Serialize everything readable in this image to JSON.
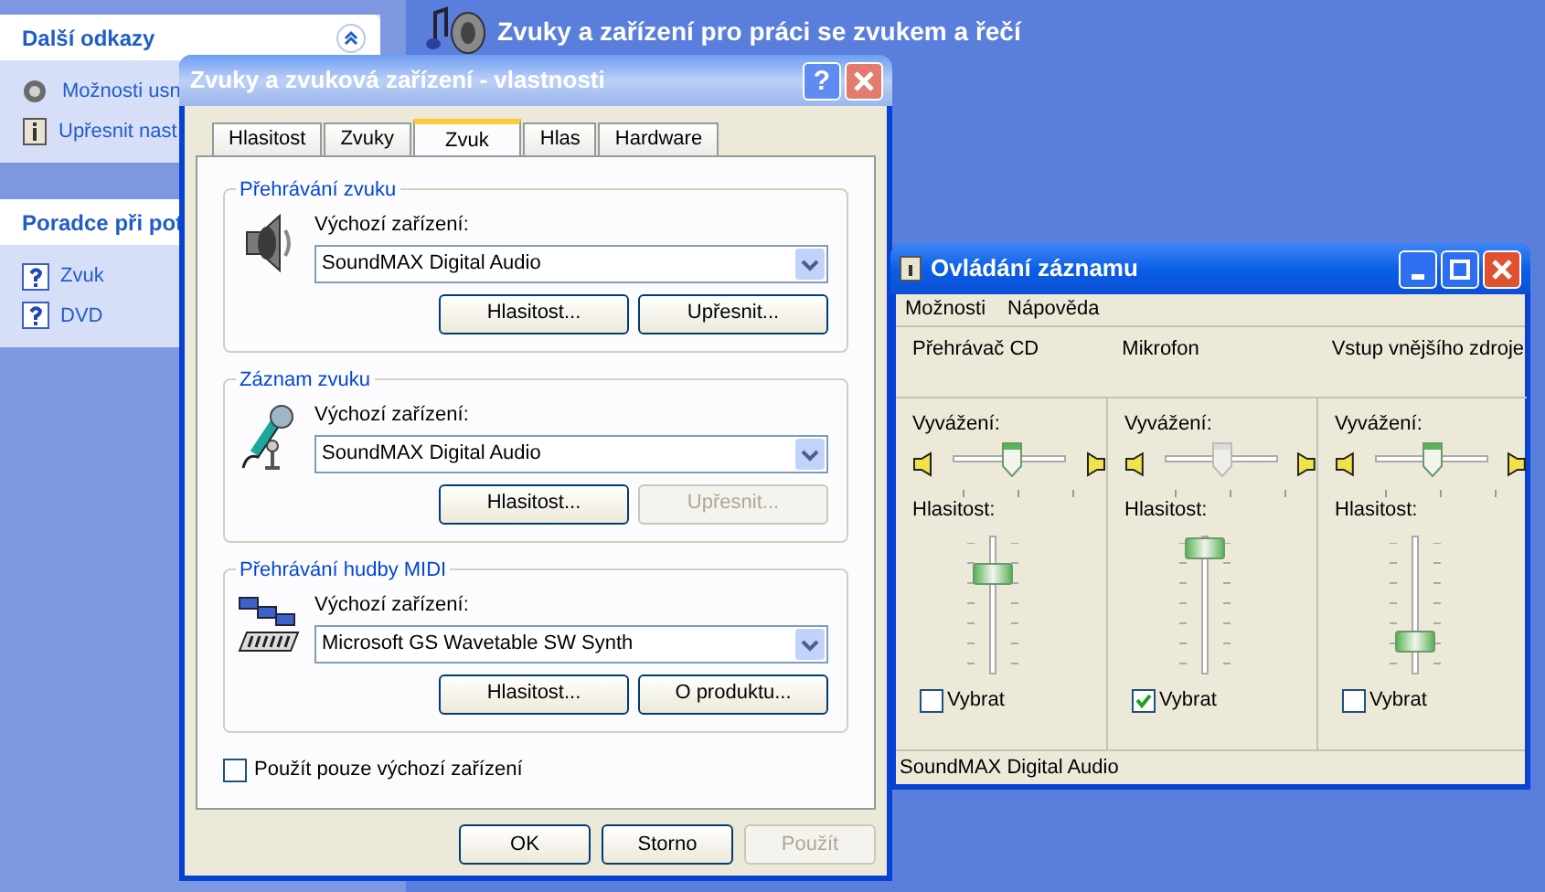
{
  "desktop_header": {
    "title": "Zvuky a zařízení pro práci se zvukem a řečí"
  },
  "sidebar": [
    {
      "title": "Další odkazy",
      "expanded": true,
      "items": [
        {
          "label": "Možnosti usn",
          "kind": "speaker"
        },
        {
          "label": "Upřesnit nast",
          "kind": "info"
        }
      ]
    },
    {
      "title": "Poradce při pot",
      "items": [
        {
          "label": "Zvuk",
          "kind": "help"
        },
        {
          "label": "DVD",
          "kind": "help"
        }
      ]
    }
  ],
  "properties_dialog": {
    "title": "Zvuky a zvuková zařízení - vlastnosti",
    "help_glyph": "?",
    "tabs": [
      {
        "label": "Hlasitost",
        "selected": false
      },
      {
        "label": "Zvuky",
        "selected": false
      },
      {
        "label": "Zvuk",
        "selected": true
      },
      {
        "label": "Hlas",
        "selected": false
      },
      {
        "label": "Hardware",
        "selected": false
      }
    ],
    "groups": [
      {
        "title": "Přehrávání zvuku",
        "kind": "speaker",
        "label": "Výchozí zařízení:",
        "device": "SoundMAX Digital Audio",
        "buttons": [
          {
            "label": "Hlasitost...",
            "disabled": false
          },
          {
            "label": "Upřesnit...",
            "disabled": false
          }
        ]
      },
      {
        "title": "Záznam zvuku",
        "kind": "microphone",
        "label": "Výchozí zařízení:",
        "device": "SoundMAX Digital Audio",
        "buttons": [
          {
            "label": "Hlasitost...",
            "disabled": false
          },
          {
            "label": "Upřesnit...",
            "disabled": true
          }
        ]
      },
      {
        "title": "Přehrávání hudby MIDI",
        "kind": "midi",
        "label": "Výchozí zařízení:",
        "device": "Microsoft GS Wavetable SW Synth",
        "buttons": [
          {
            "label": "Hlasitost...",
            "disabled": false
          },
          {
            "label": "O produktu...",
            "disabled": false
          }
        ]
      }
    ],
    "default_only": {
      "label": "Použít pouze výchozí zařízení",
      "checked": false
    },
    "buttons": [
      {
        "label": "OK",
        "disabled": false
      },
      {
        "label": "Storno",
        "disabled": false
      },
      {
        "label": "Použít",
        "disabled": true
      }
    ]
  },
  "recording_control": {
    "title": "Ovládání záznamu",
    "menu": [
      "Možnosti",
      "Nápověda"
    ],
    "channels": [
      {
        "name": "Přehrávač CD",
        "balance_label": "Vyvážení:",
        "balance": {
          "level": 0.5,
          "disabled": false
        },
        "volume_label": "Hlasitost:",
        "volume": {
          "level": 0.73
        },
        "select": {
          "label": "Vybrat",
          "checked": false
        }
      },
      {
        "name": "Mikrofon",
        "balance_label": "Vyvážení:",
        "balance": {
          "level": 0.5,
          "disabled": true
        },
        "volume_label": "Hlasitost:",
        "volume": {
          "level": 0.95
        },
        "select": {
          "label": "Vybrat",
          "checked": true
        }
      },
      {
        "name": "Vstup vnějšího zdroje",
        "balance_label": "Vyvážení:",
        "balance": {
          "level": 0.5,
          "disabled": false
        },
        "volume_label": "Hlasitost:",
        "volume": {
          "level": 0.16
        },
        "select": {
          "label": "Vybrat",
          "checked": false
        }
      }
    ],
    "status": "SoundMAX Digital Audio"
  }
}
